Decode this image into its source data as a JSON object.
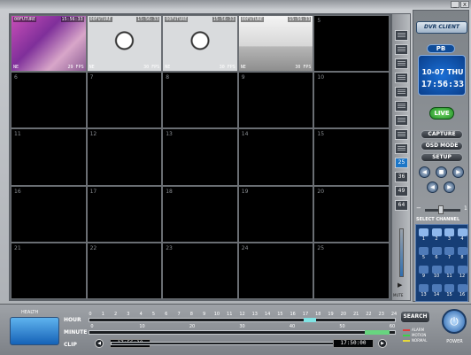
{
  "window": {
    "minimize_label": "_",
    "close_label": "x"
  },
  "grid": {
    "cells": [
      {
        "num": "1",
        "live": true,
        "tag": "00FUTURE",
        "tag_r": "15:56:33",
        "ft_l": "NE",
        "ft_r": "29 FPS",
        "scene": "pink"
      },
      {
        "num": "2",
        "live": true,
        "tag": "00FUTURE",
        "tag_r": "15:56:33",
        "ft_l": "NE",
        "ft_r": "30 FPS",
        "scene": "clock"
      },
      {
        "num": "3",
        "live": true,
        "tag": "00FUTURE",
        "tag_r": "15:56:33",
        "ft_l": "NE",
        "ft_r": "30 FPS",
        "scene": "clock"
      },
      {
        "num": "4",
        "live": true,
        "tag": "00FUTURE",
        "tag_r": "15:56:33",
        "ft_l": "NE",
        "ft_r": "30 FPS",
        "scene": "room"
      },
      {
        "num": "5"
      },
      {
        "num": "6"
      },
      {
        "num": "7"
      },
      {
        "num": "8"
      },
      {
        "num": "9"
      },
      {
        "num": "10"
      },
      {
        "num": "11"
      },
      {
        "num": "12"
      },
      {
        "num": "13"
      },
      {
        "num": "14"
      },
      {
        "num": "15"
      },
      {
        "num": "16"
      },
      {
        "num": "17"
      },
      {
        "num": "18"
      },
      {
        "num": "19"
      },
      {
        "num": "20"
      },
      {
        "num": "21"
      },
      {
        "num": "22"
      },
      {
        "num": "23"
      },
      {
        "num": "24"
      },
      {
        "num": "25"
      }
    ]
  },
  "view_buttons": [
    {
      "label": "",
      "active": false
    },
    {
      "label": "",
      "active": false
    },
    {
      "label": "",
      "active": false
    },
    {
      "label": "",
      "active": false
    },
    {
      "label": "",
      "active": false
    },
    {
      "label": "",
      "active": false
    },
    {
      "label": "",
      "active": false
    },
    {
      "label": "",
      "active": false
    },
    {
      "label": "",
      "active": false
    },
    {
      "label": "25",
      "active": true
    },
    {
      "label": "36",
      "active": false
    },
    {
      "label": "49",
      "active": false
    },
    {
      "label": "64",
      "active": false
    }
  ],
  "mute_label": "MUTE",
  "right_panel": {
    "logo": "DVR CLIENT",
    "mode": "PB",
    "date": "10-07 THU",
    "time": "17:56:33",
    "live_label": "LIVE",
    "capture_label": "CAPTURE",
    "osd_label": "OSD MODE",
    "setup_label": "SETUP",
    "zoom_value": "1",
    "select_channel_label": "SELECT CHANNEL",
    "channels": [
      "1",
      "2",
      "3",
      "4",
      "5",
      "6",
      "7",
      "8",
      "9",
      "10",
      "11",
      "12",
      "13",
      "14",
      "15",
      "16"
    ]
  },
  "bottom": {
    "health_label": "HEALTH",
    "hour_label": "HOUR",
    "minute_label": "MINUTE",
    "clip_label": "CLIP",
    "hour_ticks": [
      "0",
      "1",
      "2",
      "3",
      "4",
      "5",
      "6",
      "7",
      "8",
      "9",
      "10",
      "11",
      "12",
      "13",
      "14",
      "15",
      "16",
      "17",
      "18",
      "19",
      "20",
      "21",
      "22",
      "23",
      "24"
    ],
    "minute_ticks": [
      "0",
      "10",
      "20",
      "30",
      "40",
      "50",
      "60"
    ],
    "clip_start": "17:56:10",
    "clip_end": "17:50:00",
    "search_label": "SEARCH",
    "legend": [
      {
        "label": "ALARM",
        "color": "#e23b3b"
      },
      {
        "label": "MOTION",
        "color": "#3bd14a"
      },
      {
        "label": "NORMAL",
        "color": "#e6d93b"
      }
    ],
    "power_label": "POWER"
  }
}
